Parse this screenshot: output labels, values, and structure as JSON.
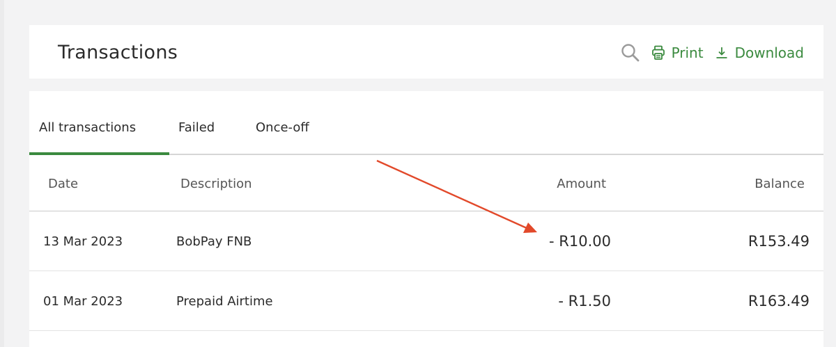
{
  "header": {
    "title": "Transactions",
    "actions": {
      "search_icon": "search-icon",
      "print_label": "Print",
      "download_label": "Download"
    }
  },
  "tabs": [
    {
      "label": "All transactions",
      "active": true
    },
    {
      "label": "Failed",
      "active": false
    },
    {
      "label": "Once-off",
      "active": false
    }
  ],
  "table": {
    "columns": {
      "date": "Date",
      "description": "Description",
      "amount": "Amount",
      "balance": "Balance"
    },
    "rows": [
      {
        "date": "13 Mar 2023",
        "description": "BobPay FNB",
        "amount": "- R10.00",
        "balance": "R153.49"
      },
      {
        "date": "01 Mar 2023",
        "description": "Prepaid Airtime",
        "amount": "- R1.50",
        "balance": "R163.49"
      }
    ]
  },
  "colors": {
    "accent_green": "#3b8a3f",
    "annotation_arrow": "#e2492a",
    "background": "#f3f3f4"
  }
}
